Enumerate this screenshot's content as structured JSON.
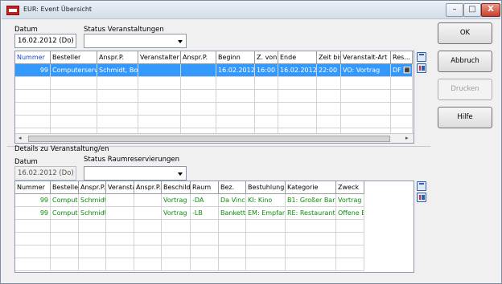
{
  "window": {
    "title": "EUR: Event Übersicht",
    "minimize_glyph": "–",
    "maximize_glyph": "□",
    "close_glyph": "X"
  },
  "top": {
    "date_label": "Datum",
    "date_value": "16.02.2012 (Do)",
    "status_label": "Status Veranstaltungen",
    "status_value": ""
  },
  "events_grid": {
    "headers": [
      "Nummer",
      "Besteller",
      "Anspr.P.",
      "Veranstalter",
      "Anspr.P.",
      "Beginn",
      "Z. von",
      "Ende",
      "Zeit bis",
      "Veranstalt-Art",
      "Res..."
    ],
    "rows": [
      [
        "99",
        "Computerservi",
        "Schmidt, Bo",
        "",
        "",
        "16.02.2012",
        "16:00",
        "16.02.2012",
        "22:00",
        "VO: Vortrag",
        "DF 🔳"
      ]
    ],
    "empty_rows": 5,
    "scroll_left": "◂",
    "scroll_right": "▸"
  },
  "details": {
    "section_label": "Details zu Veranstaltung/en",
    "date_label": "Datum",
    "date_value": "16.02.2012 (Do)",
    "status_label": "Status Raumreservierungen",
    "status_value": ""
  },
  "rooms_grid": {
    "headers": [
      "Nummer",
      "Besteller",
      "Anspr.P.",
      "Veranstalter",
      "Anspr.P.",
      "Beschilder",
      "Raum",
      "Bez.",
      "Bestuhlung",
      "Kategorie",
      "Zweck"
    ],
    "rows": [
      [
        "99",
        "Compute",
        "Schmidt",
        "",
        "",
        "Vortrag",
        "-DA",
        "Da Vinci",
        "KI: Kino",
        "B1: Großer Bar",
        "Vortrag"
      ],
      [
        "99",
        "Compute",
        "Schmidt",
        "",
        "",
        "Vortrag",
        "-LB",
        "Bankett",
        "EM: Empfan",
        "RE: Restaurant",
        "Offene E"
      ]
    ],
    "empty_rows": 4
  },
  "buttons": {
    "ok": "OK",
    "cancel": "Abbruch",
    "print": "Drucken",
    "help": "Hilfe"
  },
  "icons": {
    "grid_icon_1": "table-view-icon",
    "grid_icon_2": "columns-config-icon"
  }
}
